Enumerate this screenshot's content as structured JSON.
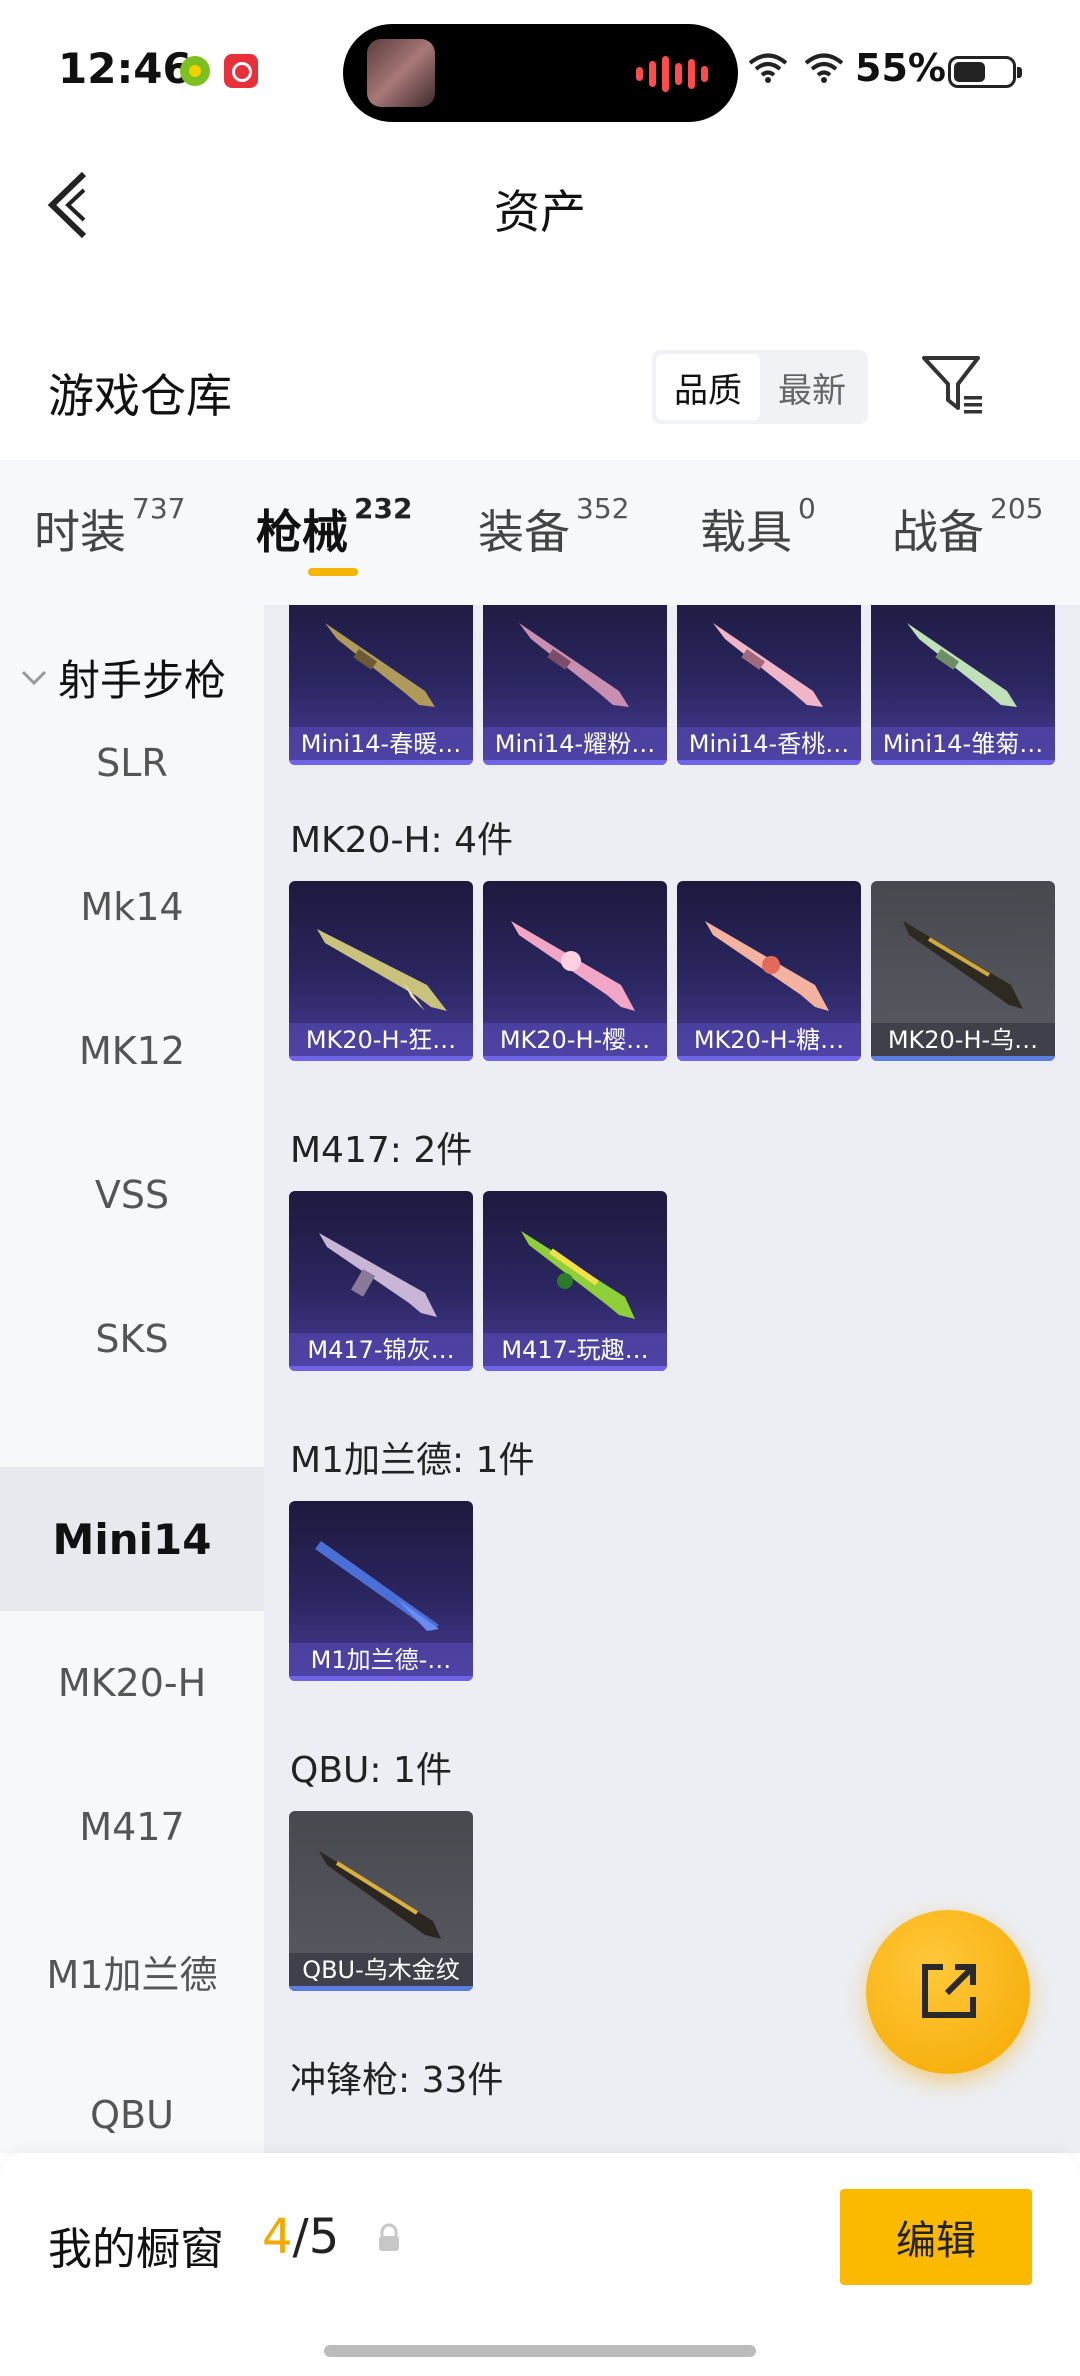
{
  "status_bar": {
    "time": "12:46",
    "battery_percent": "55%",
    "battery_level": 0.55
  },
  "header": {
    "title": "资产",
    "back_icon": "chevron-left-icon"
  },
  "warehouse": {
    "title": "游戏仓库",
    "sort_options": [
      "品质",
      "最新"
    ],
    "sort_selected": "品质",
    "filter_icon": "filter-icon"
  },
  "tabs": [
    {
      "label": "时装",
      "count": "737"
    },
    {
      "label": "枪械",
      "count": "232",
      "active": true
    },
    {
      "label": "装备",
      "count": "352"
    },
    {
      "label": "载具",
      "count": "0"
    },
    {
      "label": "战备",
      "count": "205"
    }
  ],
  "sidebar": {
    "group": "射手步枪",
    "items": [
      {
        "label": "SLR"
      },
      {
        "label": "Mk14"
      },
      {
        "label": "MK12"
      },
      {
        "label": "VSS"
      },
      {
        "label": "SKS"
      },
      {
        "label": "Mini14",
        "active": true
      },
      {
        "label": "MK20-H"
      },
      {
        "label": "M417"
      },
      {
        "label": "M1加兰德"
      },
      {
        "label": "QBU"
      }
    ]
  },
  "content": {
    "mini14_items": [
      "Mini14-春暖…",
      "Mini14-耀粉…",
      "Mini14-香桃…",
      "Mini14-雏菊…"
    ],
    "mk20_heading": "MK20-H: 4件",
    "mk20_items": [
      "MK20-H-狂…",
      "MK20-H-樱…",
      "MK20-H-糖…",
      "MK20-H-乌…"
    ],
    "m417_heading": "M417: 2件",
    "m417_items": [
      "M417-锦灰…",
      "M417-玩趣…"
    ],
    "m1_heading": "M1加兰德: 1件",
    "m1_items": [
      "M1加兰德-…"
    ],
    "qbu_heading": "QBU: 1件",
    "qbu_items": [
      "QBU-乌木金纹"
    ],
    "smg_heading": "冲锋枪: 33件"
  },
  "bottom_bar": {
    "showcase_title": "我的橱窗",
    "showcase_used": "4",
    "showcase_total": "/5",
    "edit_label": "编辑"
  },
  "colors": {
    "accent": "#f5b400",
    "card_purple": "#2b2660",
    "card_gray": "#55555c"
  }
}
